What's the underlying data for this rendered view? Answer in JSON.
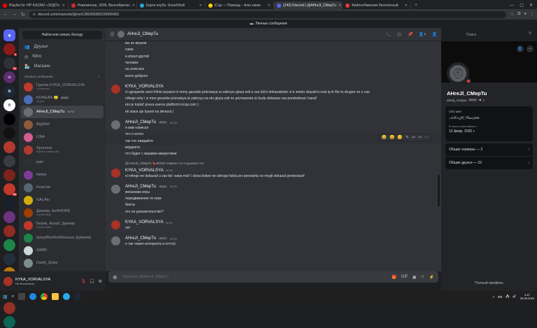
{
  "browser": {
    "tabs": [
      {
        "label": "Playlist for VIP KAZAKI «ЗОД'Ги",
        "color": "#ff0000"
      },
      {
        "label": "Ревизионер, 2009, Велнобритан",
        "color": "#d12b2b"
      },
      {
        "label": "Карта клуба: SmartShell",
        "color": "#29a3d7"
      },
      {
        "label": "iCup — Помощь - Алю какие",
        "color": "#ffd400"
      },
      {
        "label": "(243) Discord | @AHreJl_CMepTu",
        "color": "#5865f2"
      },
      {
        "label": "Файлообменник бесплатный",
        "color": "#e53935"
      }
    ],
    "url": "discord.com/channels/@me/1380266000229990463"
  },
  "window_title": "Личные сообщения",
  "servers": {
    "new_label": "НОВОЕ",
    "badges": [
      "1",
      "12",
      "",
      "",
      "",
      "",
      "",
      "",
      "",
      "",
      "44",
      "",
      "",
      "",
      "",
      "",
      "",
      "",
      "",
      "",
      ""
    ]
  },
  "dm_sidebar": {
    "search_placeholder": "Найти или начать беседу",
    "nav": [
      {
        "label": "Друзья",
        "icon": "friends-icon"
      },
      {
        "label": "Nitro",
        "icon": "nitro-icon"
      },
      {
        "label": "Магазин",
        "icon": "shop-icon"
      }
    ],
    "section_label": "Личные сообщения",
    "add_label": "+",
    "items": [
      {
        "name": "Группа KYKA_VORVALSYA",
        "sub": "1 участник",
        "color": "#c0392b",
        "boss": false
      },
      {
        "name": "KOREAN 🥲",
        "sub": "на раз",
        "color": "#4b6cb7",
        "boss": true
      },
      {
        "name": "AHreJl_CMepTu",
        "sub": "",
        "color": "#6b6e73",
        "boss": true
      },
      {
        "name": "BigWolf",
        "sub": "",
        "color": "#8e5b3c",
        "boss": false
      },
      {
        "name": "LINA",
        "sub": "",
        "color": "#d35d8f",
        "boss": false
      },
      {
        "name": "Spenreet",
        "sub": "Играет в Minecraft",
        "color": "#b03a2e",
        "boss": false
      },
      {
        "name": "pain",
        "sub": "",
        "color": "#2c2f33",
        "boss": false
      },
      {
        "name": "Netter",
        "sub": "",
        "color": "#7d3c98",
        "boss": false
      },
      {
        "name": "FearLite",
        "sub": "",
        "color": "#566573",
        "boss": false
      },
      {
        "name": "GALAtv",
        "sub": "",
        "color": "#d4ac0d",
        "boss": false
      },
      {
        "name": "Данияр, AzAMORE",
        "sub": "3 участника",
        "color": "#a04000",
        "boss": false
      },
      {
        "name": "Берик, Ayoy0, Данияр",
        "sub": "3 участника",
        "color": "#c0392b",
        "boss": false
      },
      {
        "name": "IgraydNaSke(Меньше Думаем)",
        "sub": "",
        "color": "#1e8449",
        "boss": false
      },
      {
        "name": "SABR",
        "sub": "",
        "color": "#cfd8dc",
        "boss": false
      },
      {
        "name": "Danik_Quka",
        "sub": "",
        "color": "#7f8c8d",
        "boss": false
      }
    ]
  },
  "user_panel": {
    "name": "KYKA_VORVALSYA",
    "status": "Не беспокоить"
  },
  "chat": {
    "header_name": "AHreJl_CMepTu",
    "search_placeholder": "Поиск",
    "composer_placeholder": "Написать @AHreJl_CMepTu",
    "messages": [
      {
        "type": "line",
        "text": "вы не играли"
      },
      {
        "type": "line",
        "text": "сами"
      },
      {
        "type": "line",
        "text": "а играл другой"
      },
      {
        "type": "line",
        "text": "человек"
      },
      {
        "type": "line",
        "text": "на этом все"
      },
      {
        "type": "line",
        "text": "всего доброго"
      },
      {
        "type": "author",
        "name": "KYKA_VORVALSYA",
        "boss": false,
        "time": ""
      },
      {
        "type": "line",
        "text": "vi ugrojaerte useri li4nie pryazne k nemy gavarite priznaisya ia zakroyu glaza esli u vas bili b dokazatelstv vi b smelo skazali b esst ip ili 4to to drugoe no u vas"
      },
      {
        "type": "line",
        "text": "ni4ego nety i vi mne govarite priznaisya ia zakroyu na eto glaza esli ne priznaeesta to budu dokansa vas presledovat i karat'"
      },
      {
        "type": "line",
        "text": "eto je toptat' prava userov platformi iccup.com )"
      },
      {
        "type": "line",
        "text": "eti slava uje tyanet na demout )"
      },
      {
        "type": "author",
        "name": "AHreJl_CMepTu",
        "boss": true,
        "time": "02:08"
      },
      {
        "type": "line",
        "text": "я вам написал"
      },
      {
        "type": "line",
        "text": "что я хотел"
      },
      {
        "type": "line",
        "text": "так что ожидайте"
      },
      {
        "type": "line",
        "text": "вердикта"
      },
      {
        "type": "line",
        "text": "что будет с вашими аккаунтами"
      },
      {
        "type": "reply",
        "text": "@AHreJl_CMepTu 🔖BOSS главное что я доказал это"
      },
      {
        "type": "author",
        "name": "KYKA_VORVALSYA",
        "boss": false,
        "time": "02:08"
      },
      {
        "type": "line",
        "text": "vi ni4ego ne dokazali u vas liw' vawa misl' i slova bolwe ne odnogo fakta pro pereda4u ne mogli dokazat predostavit'"
      },
      {
        "type": "author",
        "name": "AHreJl_CMepTu",
        "boss": true,
        "time": "02:09"
      },
      {
        "type": "line",
        "text": "механизм игры"
      },
      {
        "type": "line",
        "text": "передвижение по игре"
      },
      {
        "type": "line",
        "text": "бинты"
      },
      {
        "type": "line",
        "text": "это не доказательство?"
      },
      {
        "type": "author",
        "name": "KYKA_VORVALSYA",
        "boss": false,
        "time": "02:09"
      },
      {
        "type": "line",
        "text": "net"
      },
      {
        "type": "author",
        "name": "AHreJl_CMepTu",
        "boss": true,
        "time": "02:09"
      },
      {
        "type": "line",
        "text": "я так ловил интернета и нотта)"
      }
    ],
    "reactions": [
      "😂",
      "😀",
      "😊",
      "✎",
      "↩",
      "↪",
      "⋯"
    ]
  },
  "profile": {
    "name": "AHreJl_CMepTu",
    "handle": "ahrejl_cmeptu",
    "card_label": "Обо мне",
    "nickname": "𝒜𝒦𝓇𝑒𝒥𝓁_𝒞𝓂𝑒𝓅𝓉𝓊",
    "since_label": "В числе участников с",
    "since_date": "12 февр. 2020 г.",
    "mutual_servers": "Общие серверы — 2",
    "mutual_friends": "Общие друзья — 23",
    "full_profile": "Полный профиль"
  },
  "taskbar": {
    "lang": "EN",
    "time": "2:47",
    "date": "30.06.2025"
  }
}
